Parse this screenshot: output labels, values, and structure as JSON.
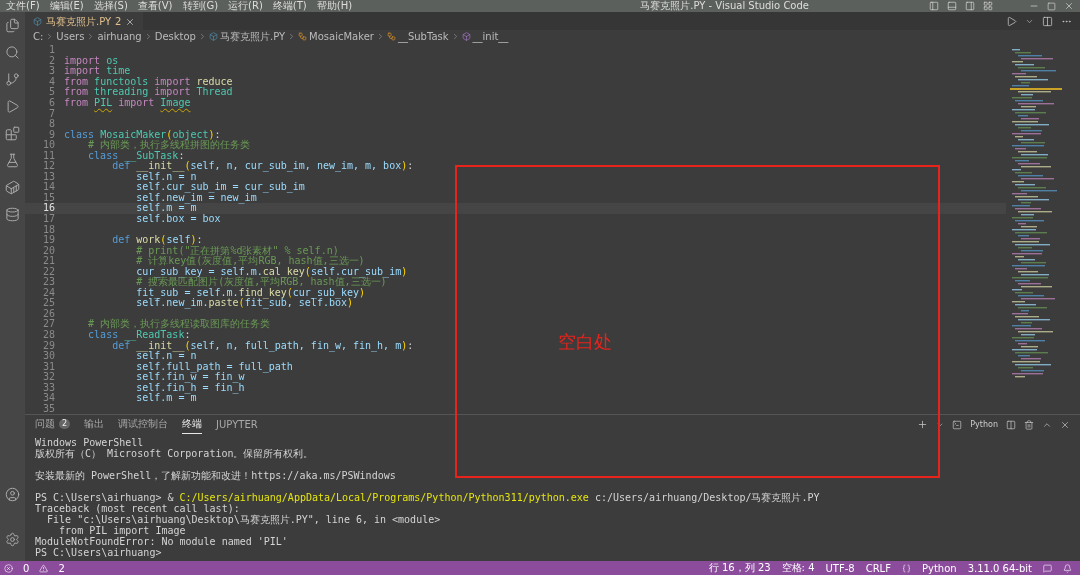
{
  "window": {
    "title": "马赛克照片.PY - Visual Studio Code"
  },
  "menu": [
    "文件(F)",
    "编辑(E)",
    "选择(S)",
    "查看(V)",
    "转到(G)",
    "运行(R)",
    "终端(T)",
    "帮助(H)"
  ],
  "tabs": [
    {
      "label": "马赛克照片.PY",
      "badge": "2",
      "selected": true
    }
  ],
  "breadcrumbs": [
    {
      "kind": "plain",
      "text": "C:"
    },
    {
      "kind": "plain",
      "text": "Users"
    },
    {
      "kind": "plain",
      "text": "airhuang"
    },
    {
      "kind": "plain",
      "text": "Desktop"
    },
    {
      "kind": "file",
      "text": "马赛克照片.PY"
    },
    {
      "kind": "class",
      "text": "MosaicMaker"
    },
    {
      "kind": "class",
      "text": "__SubTask"
    },
    {
      "kind": "method",
      "text": "__init__"
    }
  ],
  "code_lines": [
    {
      "number": "1",
      "current": false
    },
    {
      "number": "2",
      "current": false,
      "tokens": [
        {
          "kind": "kw",
          "text": "import"
        },
        {
          "kind": "cls",
          "text": " os"
        }
      ]
    },
    {
      "number": "3",
      "current": false,
      "tokens": [
        {
          "kind": "kw",
          "text": "import"
        },
        {
          "kind": "cls",
          "text": " time"
        }
      ]
    },
    {
      "number": "4",
      "current": false,
      "tokens": [
        {
          "kind": "kw",
          "text": "from"
        },
        {
          "kind": "cls",
          "text": " functools "
        },
        {
          "kind": "kw",
          "text": "import"
        },
        {
          "kind": "fn",
          "text": " reduce"
        }
      ]
    },
    {
      "number": "5",
      "current": false,
      "tokens": [
        {
          "kind": "kw",
          "text": "from"
        },
        {
          "kind": "cls",
          "text": " threading "
        },
        {
          "kind": "kw",
          "text": "import"
        },
        {
          "kind": "cls",
          "text": " Thread"
        }
      ]
    },
    {
      "number": "6",
      "current": false,
      "tokens": [
        {
          "kind": "kw",
          "text": "from "
        },
        {
          "kind": "warn",
          "text": "PIL"
        },
        {
          "kind": "kw",
          "text": " import "
        },
        {
          "kind": "warn",
          "text": "Image"
        }
      ]
    },
    {
      "number": "7",
      "current": false
    },
    {
      "number": "8",
      "current": false
    },
    {
      "number": "9",
      "current": false,
      "tokens": [
        {
          "kind": "def",
          "text": "class"
        },
        {
          "kind": "cls",
          "text": " MosaicMaker"
        },
        {
          "kind": "paren",
          "text": "("
        },
        {
          "kind": "cls",
          "text": "object"
        },
        {
          "kind": "paren",
          "text": ")"
        },
        {
          "kind": "plain",
          "text": ":"
        }
      ]
    },
    {
      "number": "10",
      "current": false,
      "tokens": [
        {
          "kind": "cm",
          "text": "    # 内部类，执行多线程拼图的任务类"
        }
      ]
    },
    {
      "number": "11",
      "current": false,
      "tokens": [
        {
          "kind": "def",
          "text": "    class"
        },
        {
          "kind": "cls",
          "text": " __SubTask"
        },
        {
          "kind": "plain",
          "text": ":"
        }
      ]
    },
    {
      "number": "12",
      "current": false,
      "tokens": [
        {
          "kind": "def",
          "text": "        def"
        },
        {
          "kind": "fn",
          "text": " __init__"
        },
        {
          "kind": "paren",
          "text": "("
        },
        {
          "kind": "var",
          "text": "self, n, cur_sub_im, new_im, m, box"
        },
        {
          "kind": "paren",
          "text": ")"
        },
        {
          "kind": "plain",
          "text": ":"
        }
      ]
    },
    {
      "number": "13",
      "current": false,
      "tokens": [
        {
          "kind": "var",
          "text": "            self.n = n"
        }
      ]
    },
    {
      "number": "14",
      "current": false,
      "tokens": [
        {
          "kind": "var",
          "text": "            self.cur_sub_im = cur_sub_im"
        }
      ]
    },
    {
      "number": "15",
      "current": false,
      "tokens": [
        {
          "kind": "var",
          "text": "            self.new_im = new_im"
        }
      ]
    },
    {
      "number": "16",
      "current": true,
      "tokens": [
        {
          "kind": "var",
          "text": "            self.m = m"
        }
      ]
    },
    {
      "number": "17",
      "current": false,
      "tokens": [
        {
          "kind": "var",
          "text": "            self.box = box"
        }
      ]
    },
    {
      "number": "18",
      "current": false
    },
    {
      "number": "19",
      "current": false,
      "tokens": [
        {
          "kind": "def",
          "text": "        def"
        },
        {
          "kind": "fn",
          "text": " work"
        },
        {
          "kind": "paren",
          "text": "("
        },
        {
          "kind": "var",
          "text": "self"
        },
        {
          "kind": "paren",
          "text": ")"
        },
        {
          "kind": "plain",
          "text": ":"
        }
      ]
    },
    {
      "number": "20",
      "current": false,
      "tokens": [
        {
          "kind": "cm",
          "text": "            # print(\"正在拼第%d张素材\" % self.n)"
        }
      ]
    },
    {
      "number": "21",
      "current": false,
      "tokens": [
        {
          "kind": "cm",
          "text": "            # 计算key值(灰度值,平均RGB, hash值,三选一)"
        }
      ]
    },
    {
      "number": "22",
      "current": false,
      "tokens": [
        {
          "kind": "var",
          "text": "            cur_sub_key = self.m."
        },
        {
          "kind": "fn",
          "text": "cal_key"
        },
        {
          "kind": "paren",
          "text": "("
        },
        {
          "kind": "var",
          "text": "self.cur_sub_im"
        },
        {
          "kind": "paren",
          "text": ")"
        }
      ]
    },
    {
      "number": "23",
      "current": false,
      "tokens": [
        {
          "kind": "cm",
          "text": "            # 搜索最匹配图片(灰度值,平均RGB, hash值,三选一)"
        }
      ]
    },
    {
      "number": "24",
      "current": false,
      "tokens": [
        {
          "kind": "var",
          "text": "            fit_sub = self.m."
        },
        {
          "kind": "fn",
          "text": "find_key"
        },
        {
          "kind": "paren",
          "text": "("
        },
        {
          "kind": "var",
          "text": "cur_sub_key"
        },
        {
          "kind": "paren",
          "text": ")"
        }
      ]
    },
    {
      "number": "25",
      "current": false,
      "tokens": [
        {
          "kind": "var",
          "text": "            self.new_im."
        },
        {
          "kind": "fn",
          "text": "paste"
        },
        {
          "kind": "paren",
          "text": "("
        },
        {
          "kind": "var",
          "text": "fit_sub, self.box"
        },
        {
          "kind": "paren",
          "text": ")"
        }
      ]
    },
    {
      "number": "26",
      "current": false
    },
    {
      "number": "27",
      "current": false,
      "tokens": [
        {
          "kind": "cm",
          "text": "    # 内部类，执行多线程读取图库的任务类"
        }
      ]
    },
    {
      "number": "28",
      "current": false,
      "tokens": [
        {
          "kind": "def",
          "text": "    class"
        },
        {
          "kind": "cls",
          "text": " __ReadTask"
        },
        {
          "kind": "plain",
          "text": ":"
        }
      ]
    },
    {
      "number": "29",
      "current": false,
      "tokens": [
        {
          "kind": "def",
          "text": "        def"
        },
        {
          "kind": "fn",
          "text": " __init__"
        },
        {
          "kind": "paren",
          "text": "("
        },
        {
          "kind": "var",
          "text": "self, n, full_path, fin_w, fin_h, m"
        },
        {
          "kind": "paren",
          "text": ")"
        },
        {
          "kind": "plain",
          "text": ":"
        }
      ]
    },
    {
      "number": "30",
      "current": false,
      "tokens": [
        {
          "kind": "var",
          "text": "            self.n = n"
        }
      ]
    },
    {
      "number": "31",
      "current": false,
      "tokens": [
        {
          "kind": "var",
          "text": "            self.full_path = full_path"
        }
      ]
    },
    {
      "number": "32",
      "current": false,
      "tokens": [
        {
          "kind": "var",
          "text": "            self.fin_w = fin_w"
        }
      ]
    },
    {
      "number": "33",
      "current": false,
      "tokens": [
        {
          "kind": "var",
          "text": "            self.fin_h = fin_h"
        }
      ]
    },
    {
      "number": "34",
      "current": false,
      "tokens": [
        {
          "kind": "var",
          "text": "            self.m = m"
        }
      ]
    },
    {
      "number": "35",
      "current": false
    }
  ],
  "annotation": {
    "label": "空白处"
  },
  "panel": {
    "tabs": [
      {
        "label": "问题",
        "badge": "2",
        "selected": false
      },
      {
        "label": "输出",
        "selected": false
      },
      {
        "label": "调试控制台",
        "selected": false
      },
      {
        "label": "终端",
        "selected": true
      },
      {
        "label": "JUPYTER",
        "selected": false
      }
    ],
    "terminal_name": "Python",
    "terminal_blocks": [
      [
        {
          "tokens": [
            {
              "kind": "plain",
              "text": "Windows PowerShell"
            }
          ]
        },
        {
          "tokens": [
            {
              "kind": "plain",
              "text": "版权所有（C） Microsoft Corporation。保留所有权利。"
            }
          ]
        }
      ],
      [
        {
          "tokens": [
            {
              "kind": "plain",
              "text": "安装最新的 PowerShell，了解新功能和改进！https://aka.ms/PSWindows"
            }
          ]
        }
      ],
      [
        {
          "tokens": [
            {
              "kind": "plain",
              "text": "PS C:\\Users\\airhuang> & "
            },
            {
              "kind": "path",
              "text": "C:/Users/airhuang/AppData/Local/Programs/Python/Python311/python.exe"
            },
            {
              "kind": "plain",
              "text": " c:/Users/airhuang/Desktop/马赛克照片.PY"
            }
          ]
        },
        {
          "tokens": [
            {
              "kind": "plain",
              "text": "Traceback (most recent call last):"
            }
          ]
        },
        {
          "tokens": [
            {
              "kind": "plain",
              "text": "  File \"c:\\Users\\airhuang\\Desktop\\马赛克照片.PY\", line 6, in <module>"
            }
          ]
        },
        {
          "tokens": [
            {
              "kind": "plain",
              "text": "    from PIL import Image"
            }
          ]
        },
        {
          "tokens": [
            {
              "kind": "plain",
              "text": "ModuleNotFoundError: No module named 'PIL'"
            }
          ]
        },
        {
          "tokens": [
            {
              "kind": "plain",
              "text": "PS C:\\Users\\airhuang>"
            }
          ]
        }
      ]
    ]
  },
  "status_bar": {
    "errors": "0",
    "warnings": "2",
    "items": [
      {
        "kind": "text",
        "text": "行 16，列 23"
      },
      {
        "kind": "text",
        "text": "空格: 4"
      },
      {
        "kind": "text",
        "text": "UTF-8"
      },
      {
        "kind": "text",
        "text": "CRLF"
      },
      {
        "kind": "language",
        "text": "Python"
      },
      {
        "kind": "text",
        "text": "3.11.0 64-bit"
      }
    ]
  }
}
